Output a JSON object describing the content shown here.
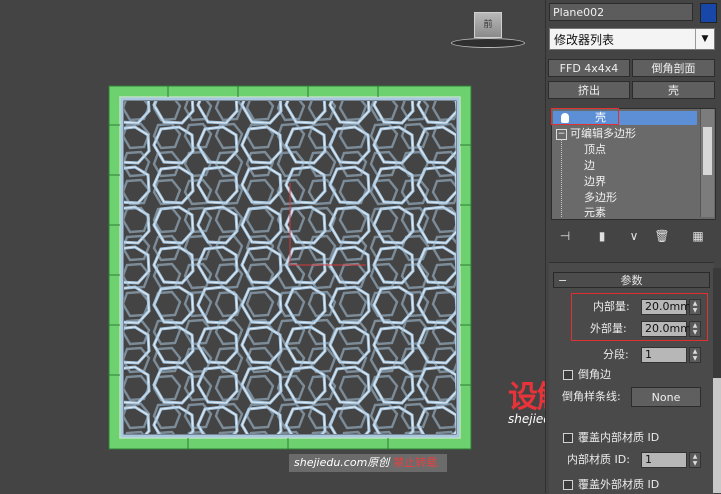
{
  "viewport": {
    "viewcube_label": "前",
    "watermark_main": "shejiedu.com原创",
    "watermark_notice": "禁止转载",
    "logo_text": "设解读",
    "logo_url": "shejiedu.com"
  },
  "panel": {
    "object_name": "Plane002",
    "modifier_list": "修改器列表",
    "buttons": {
      "ffd": "FFD 4x4x4",
      "chamfer_profile": "倒角剖面",
      "extrude": "挤出",
      "shell": "壳"
    },
    "stack": {
      "selected": "壳",
      "base": "可编辑多边形",
      "sub_items": [
        "顶点",
        "边",
        "边界",
        "多边形",
        "元素"
      ]
    },
    "params": {
      "header": "参数",
      "inner_amount_label": "内部量:",
      "inner_amount_value": "20.0mm",
      "outer_amount_label": "外部量:",
      "outer_amount_value": "20.0mm",
      "segments_label": "分段:",
      "segments_value": "1",
      "bevel_edges_label": "倒角边",
      "bevel_spline_label": "倒角样条线:",
      "bevel_spline_value": "None",
      "override_inner_mat_label": "覆盖内部材质 ID",
      "inner_mat_id_label": "内部材质 ID:",
      "inner_mat_id_value": "1",
      "override_outer_mat_label": "覆盖外部材质 ID"
    }
  },
  "colors": {
    "background": "#444444",
    "mesh_frame_green": "#6dd16f",
    "mesh_edge_light": "#a9c7df",
    "selection_blue": "#5c8fd6",
    "highlight_red": "#e03030",
    "object_color": "#1747a8"
  }
}
